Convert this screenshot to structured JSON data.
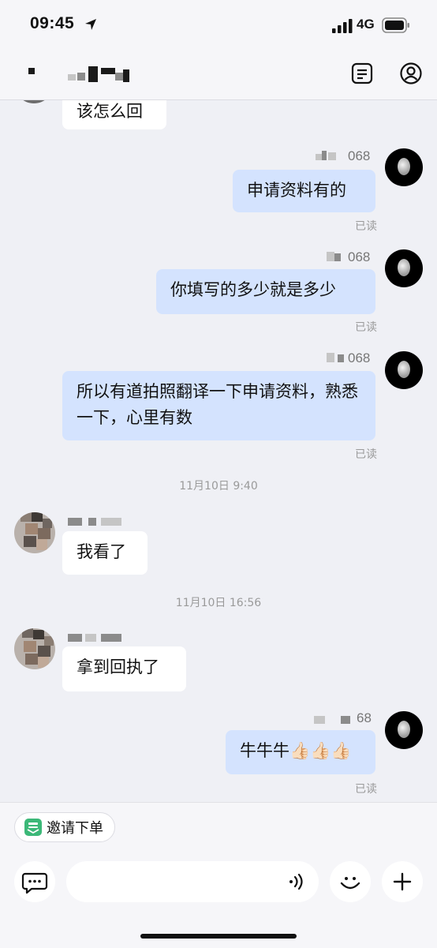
{
  "status": {
    "time": "09:45",
    "network": "4G"
  },
  "messages": {
    "m0": "该怎么回",
    "m1": "申请资料有的",
    "m2": "你填写的多少就是多少",
    "m3": "所以有道拍照翻译一下申请资料，熟悉一下，心里有数",
    "m4": "我看了",
    "m5": "拿到回执了",
    "m6": "牛牛牛👍🏻👍🏻👍🏻"
  },
  "read_label": "已读",
  "sender_ids": [
    "068",
    "068",
    "068",
    "68"
  ],
  "timestamps": [
    "11月10日 9:40",
    "11月10日 16:56"
  ],
  "footer": {
    "chip_label": "邀请下单"
  },
  "icons": [
    "location-arrow-icon",
    "signal-icon",
    "battery-icon",
    "notes-icon",
    "profile-icon",
    "chat-bubble-icon",
    "voice-icon",
    "smiley-icon",
    "plus-icon",
    "invite-order-icon"
  ],
  "colors": {
    "outgoing_bubble": "#d4e3fe",
    "incoming_bubble": "#ffffff",
    "background": "#eff0f5",
    "chip_icon": "#3cb878"
  }
}
